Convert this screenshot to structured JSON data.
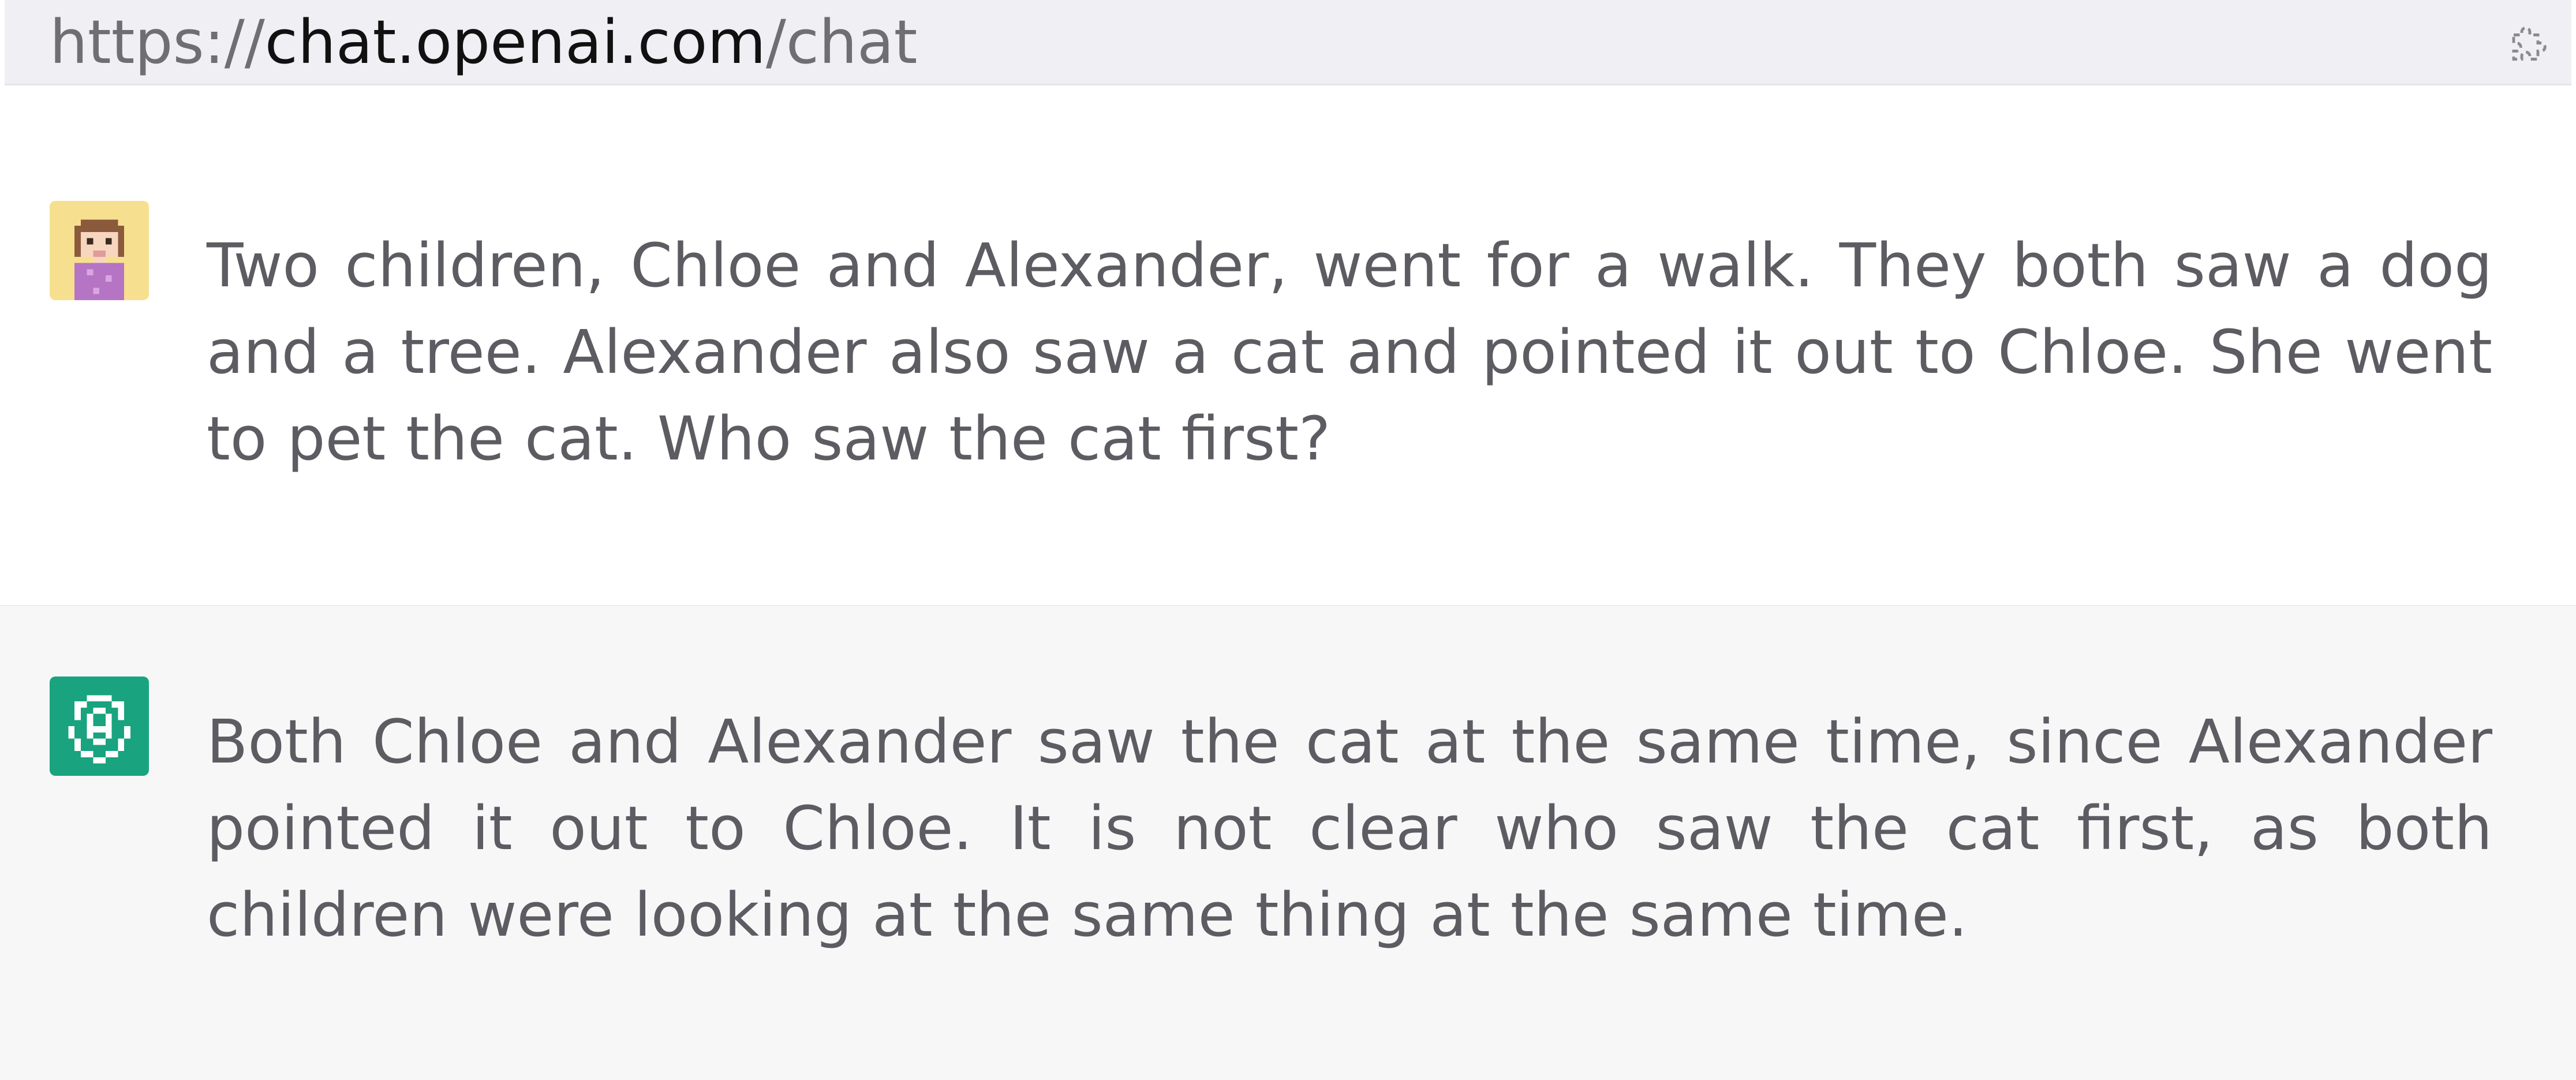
{
  "address_bar": {
    "scheme": "https://",
    "domain": "chat.openai.com",
    "path": "/chat",
    "extension_icon": "extension-puzzle-icon"
  },
  "conversation": {
    "user_message": {
      "avatar_icon": "pixel-girl-avatar-icon",
      "text": "Two children, Chloe and Alexander, went for a walk. They both saw a dog and a tree. Alexander also saw a cat and pointed it out to Chloe. She went to pet the cat. Who saw the cat first?"
    },
    "assistant_message": {
      "avatar_icon": "chatgpt-logo-icon",
      "text": "Both Chloe and Alexander saw the cat at the same time, since Alexander pointed it out to Chloe. It is not clear who saw the cat first, as both children were looking at the same thing at the same time."
    }
  },
  "colors": {
    "address_bar_bg": "#f0eff4",
    "assistant_bg": "#f7f7f8",
    "text": "#5c5c62",
    "chatgpt_green": "#19a37f",
    "user_avatar_bg": "#f6e08f"
  }
}
